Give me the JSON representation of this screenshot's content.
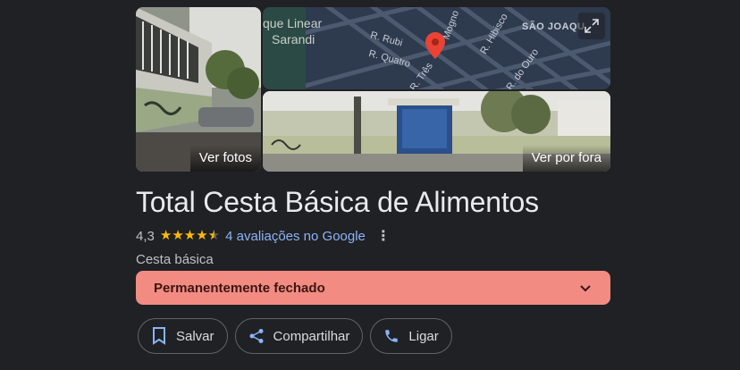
{
  "gallery": {
    "photos_label": "Ver fotos",
    "street_label": "Ver por fora",
    "map_labels": {
      "park": "que Linear",
      "district": "Sarandi",
      "street_rubi": "R. Rubi",
      "street_quatro": "R. Quatro",
      "street_tres": "R. Três",
      "street_mogno": "Mogno",
      "street_hibisco": "R. Hibisco",
      "street_ouro": "R. do Ouro",
      "neighborhood": "SÃO JOAQU"
    }
  },
  "place": {
    "name": "Total Cesta Básica de Alimentos",
    "rating": "4,3",
    "stars_filled": 4.3,
    "reviews_label": "4 avaliações no Google",
    "category": "Cesta básica",
    "status": "Permanentemente fechado"
  },
  "actions": [
    {
      "label": "Salvar",
      "icon": "bookmark-icon"
    },
    {
      "label": "Compartilhar",
      "icon": "share-icon"
    },
    {
      "label": "Ligar",
      "icon": "phone-icon"
    }
  ],
  "colors": {
    "background": "#202124",
    "status": "#f28b82",
    "star": "#fbbc04",
    "link": "#8ab4f8",
    "pin": "#ea4335"
  }
}
